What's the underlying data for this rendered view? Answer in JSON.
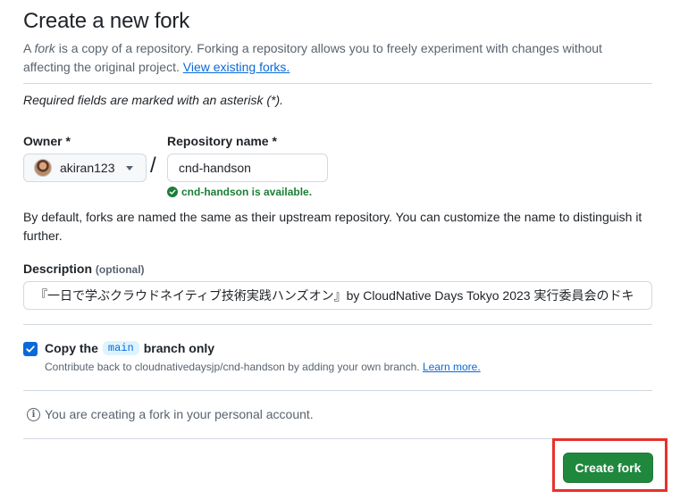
{
  "header": {
    "title": "Create a new fork",
    "intro_prefix": "A ",
    "intro_em": "fork",
    "intro_rest": " is a copy of a repository. Forking a repository allows you to freely experiment with changes without affecting the original project. ",
    "view_forks_link": "View existing forks."
  },
  "required_note": "Required fields are marked with an asterisk (*).",
  "owner": {
    "label": "Owner *",
    "value": "akiran123"
  },
  "separator": "/",
  "repository": {
    "label": "Repository name *",
    "value": "cnd-handson",
    "availability": "cnd-handson is available."
  },
  "default_note": "By default, forks are named the same as their upstream repository. You can customize the name to distinguish it further.",
  "description": {
    "label": "Description",
    "optional": "(optional)",
    "value": "『一日で学ぶクラウドネイティブ技術実践ハンズオン』by CloudNative Days Tokyo 2023 実行委員会のドキ"
  },
  "copy_branch": {
    "checked": true,
    "label_prefix": "Copy the",
    "branch": "main",
    "label_suffix": "branch only",
    "helper_text": "Contribute back to cloudnativedaysjp/cnd-handson by adding your own branch.",
    "learn_more": "Learn more."
  },
  "account_note": "You are creating a fork in your personal account.",
  "actions": {
    "create_fork": "Create fork",
    "accent_color": "#1f883d",
    "highlight_color": "#e8312a"
  },
  "colors": {
    "link": "#0969da",
    "success": "#1a7f37",
    "muted": "#59636e"
  }
}
